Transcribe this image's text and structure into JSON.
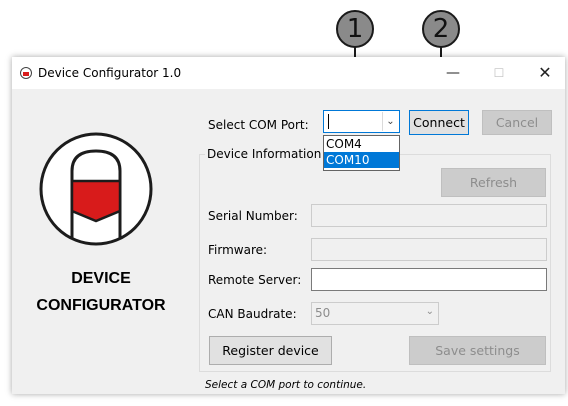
{
  "callouts": {
    "first": "1",
    "second": "2"
  },
  "window": {
    "title": "Device Configurator 1.0",
    "minimize_glyph": "—",
    "maximize_glyph": "☐",
    "close_glyph": "✕"
  },
  "brand": {
    "line1": "DEVICE",
    "line2": "CONFIGURATOR"
  },
  "com_port": {
    "label": "Select COM Port:",
    "value": "",
    "options": [
      "COM4",
      "COM10"
    ],
    "highlighted_option": "COM10"
  },
  "buttons": {
    "connect": "Connect",
    "cancel": "Cancel",
    "refresh": "Refresh",
    "register": "Register device",
    "save": "Save settings"
  },
  "device_info": {
    "group_title": "Device Information",
    "serial_label": "Serial Number:",
    "serial_value": "",
    "firmware_label": "Firmware:",
    "firmware_value": "",
    "remote_label": "Remote Server:",
    "remote_value": "",
    "baud_label": "CAN Baudrate:",
    "baud_value": "50"
  },
  "status": "Select a COM port to continue.",
  "colors": {
    "accent": "#0078d7",
    "brand_red": "#d81b1b",
    "window_bg": "#f0f0f0"
  }
}
